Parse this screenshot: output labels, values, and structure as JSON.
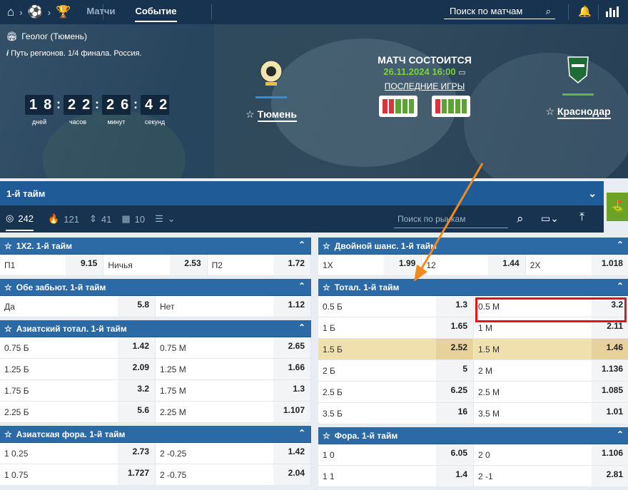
{
  "nav": {
    "tabs": [
      {
        "label": "Матчи"
      },
      {
        "label": "Событие"
      }
    ],
    "search_label": "Поиск по матчам"
  },
  "match": {
    "league": "Геолог (Тюмень)",
    "tournament": "Путь регионов. 1/4 финала. Россия.",
    "timer": {
      "days": "18",
      "hours": "22",
      "minutes": "26",
      "seconds": "42",
      "labels": {
        "days": "дней",
        "hours": "часов",
        "minutes": "минут",
        "seconds": "секунд"
      }
    },
    "home": {
      "name": "Тюмень",
      "color": "#2f8fd8"
    },
    "away": {
      "name": "Краснодар",
      "color": "#6db33f"
    },
    "status": "МАТЧ СОСТОИТСЯ",
    "datetime": "26.11.2024 16:00",
    "last_games": "ПОСЛЕДНИЕ ИГРЫ"
  },
  "section": {
    "title": "1-й тайм"
  },
  "filters": {
    "counts": [
      "242",
      "121",
      "41",
      "10"
    ],
    "market_search": "Поиск по рынкам"
  },
  "markets_left": [
    {
      "title": "1Х2. 1-й тайм",
      "rows": [
        [
          [
            "П1",
            "9.15"
          ],
          [
            "Ничья",
            "2.53"
          ],
          [
            "П2",
            "1.72"
          ]
        ]
      ]
    },
    {
      "title": "Обе забьют. 1-й тайм",
      "rows": [
        [
          [
            "Да",
            "5.8"
          ],
          [
            "Нет",
            "1.12"
          ]
        ]
      ]
    },
    {
      "title": "Азиатский тотал. 1-й тайм",
      "rows": [
        [
          [
            "0.75 Б",
            "1.42"
          ],
          [
            "0.75 М",
            "2.65"
          ]
        ],
        [
          [
            "1.25 Б",
            "2.09"
          ],
          [
            "1.25 М",
            "1.66"
          ]
        ],
        [
          [
            "1.75 Б",
            "3.2"
          ],
          [
            "1.75 М",
            "1.3"
          ]
        ],
        [
          [
            "2.25 Б",
            "5.6"
          ],
          [
            "2.25 М",
            "1.107"
          ]
        ]
      ]
    },
    {
      "title": "Азиатская фора. 1-й тайм",
      "rows": [
        [
          [
            "1 0.25",
            "2.73"
          ],
          [
            "2 -0.25",
            "1.42"
          ]
        ],
        [
          [
            "1 0.75",
            "1.727"
          ],
          [
            "2 -0.75",
            "2.04"
          ]
        ]
      ]
    }
  ],
  "markets_right": [
    {
      "title": "Двойной шанс. 1-й тайм",
      "rows": [
        [
          [
            "1Х",
            "1.99"
          ],
          [
            "12",
            "1.44"
          ],
          [
            "2Х",
            "1.018"
          ]
        ]
      ]
    },
    {
      "title": "Тотал. 1-й тайм",
      "rows": [
        [
          [
            "0.5 Б",
            "1.3"
          ],
          [
            "0.5 М",
            "3.2"
          ]
        ],
        [
          [
            "1 Б",
            "1.65"
          ],
          [
            "1 М",
            "2.11"
          ]
        ],
        [
          [
            "1.5 Б",
            "2.52"
          ],
          [
            "1.5 М",
            "1.46"
          ]
        ],
        [
          [
            "2 Б",
            "5"
          ],
          [
            "2 М",
            "1.136"
          ]
        ],
        [
          [
            "2.5 Б",
            "6.25"
          ],
          [
            "2.5 М",
            "1.085"
          ]
        ],
        [
          [
            "3.5 Б",
            "16"
          ],
          [
            "3.5 М",
            "1.01"
          ]
        ]
      ]
    },
    {
      "title": "Фора. 1-й тайм",
      "rows": [
        [
          [
            "1 0",
            "6.05"
          ],
          [
            "2 0",
            "1.106"
          ]
        ],
        [
          [
            "1 1",
            "1.4"
          ],
          [
            "2 -1",
            "2.81"
          ]
        ]
      ]
    }
  ],
  "colors": {
    "accent": "#2c6aa6",
    "nav": "#17334f",
    "highlight": "#efe0ad",
    "annotation": "#e3141b",
    "arrow": "#f28a1e"
  }
}
